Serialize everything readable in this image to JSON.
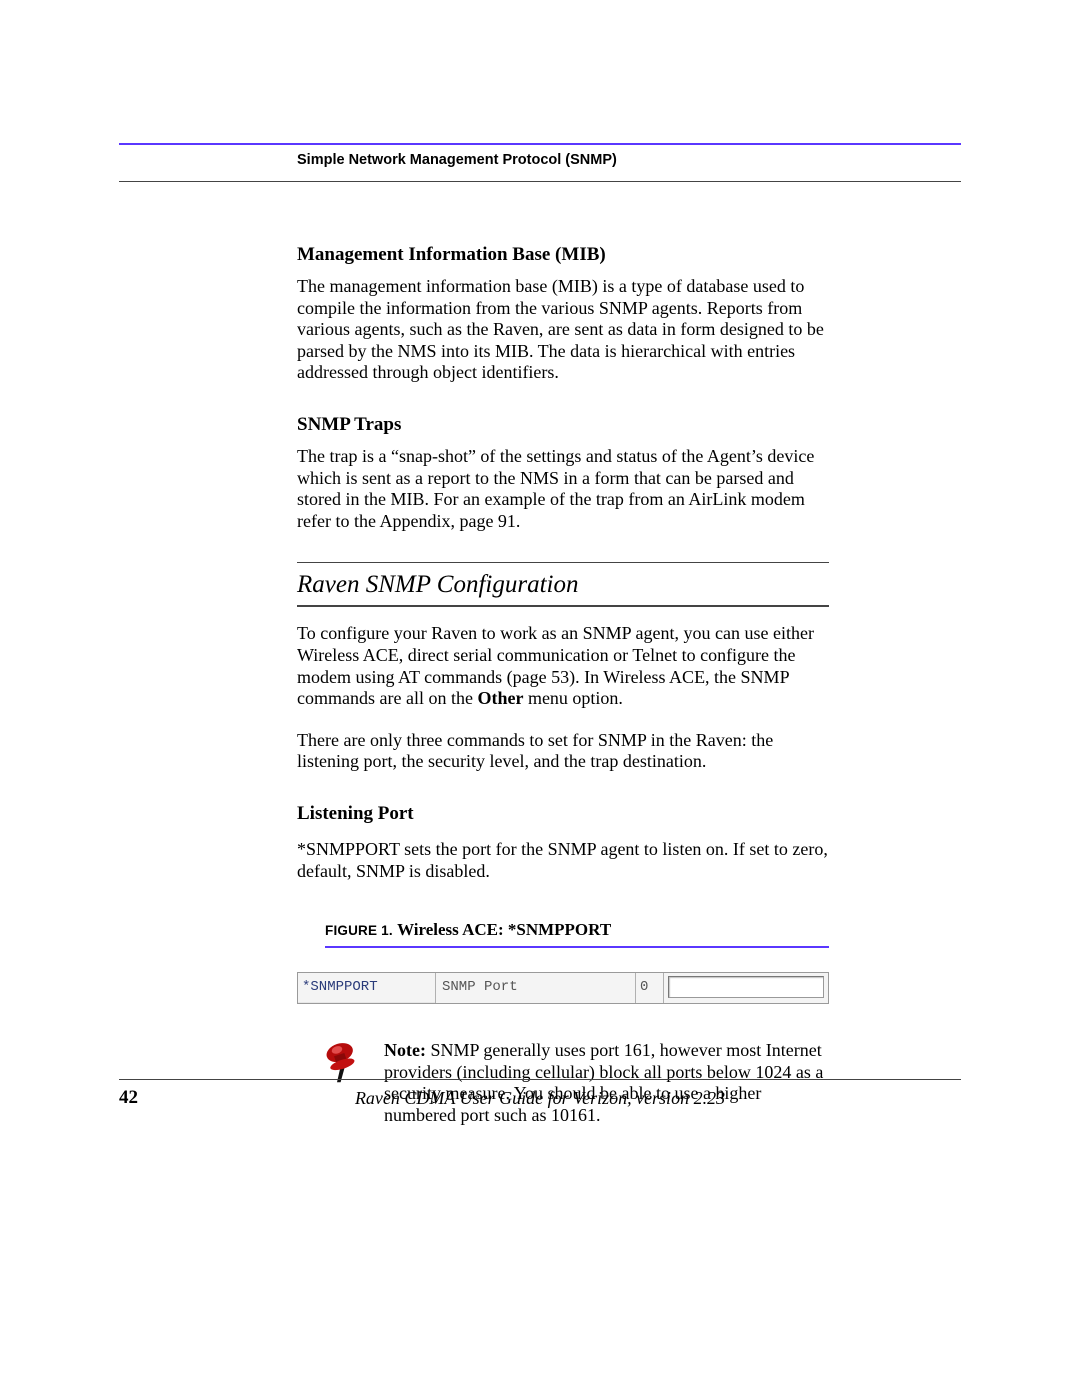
{
  "running_head": "Simple Network Management Protocol (SNMP)",
  "sections": {
    "mib": {
      "heading": "Management Information Base (MIB)",
      "body": "The management information base (MIB) is a type of database used to compile the information from the various SNMP agents.  Reports from various agents, such as the Raven, are sent as data in form designed to be parsed by the NMS into its MIB.  The data is hierarchical with entries addressed through object identifiers."
    },
    "traps": {
      "heading": "SNMP Traps",
      "body": "The trap is a “snap-shot” of the settings and status of the Agent’s device which is sent as a report to the NMS in a form that can be parsed and stored in the MIB.  For an example of the trap from an AirLink modem refer to the Appendix, page 91."
    },
    "config": {
      "heading": "Raven SNMP Configuration",
      "p1_a": "To configure your Raven to work as an SNMP agent, you can use either Wireless ACE, direct serial communication or Telnet to configure the modem using AT commands (page 53). In Wireless ACE, the SNMP commands are all on the ",
      "p1_bold": "Other",
      "p1_b": " menu option.",
      "p2": "There are only three commands to set for SNMP in the Raven: the listening port, the security level, and the trap destination."
    },
    "listening": {
      "heading": "Listening Port",
      "body": "*SNMPPORT sets the port for the SNMP agent to listen on.  If set to zero, default, SNMP is disabled."
    }
  },
  "figure": {
    "label": "FIGURE 1.",
    "title": "Wireless ACE: *SNMPPORT",
    "cells": {
      "cmd": "*SNMPPORT",
      "desc": "SNMP Port",
      "val": "0"
    }
  },
  "note": {
    "bold": "Note: ",
    "text": "SNMP generally uses port 161, however most Internet providers (including cellular) block all ports below 1024 as a security measure.  You should be able to use a higher numbered port such as 10161."
  },
  "footer": {
    "page": "42",
    "title": "Raven CDMA User Guide for Verizon, version 2.23"
  }
}
